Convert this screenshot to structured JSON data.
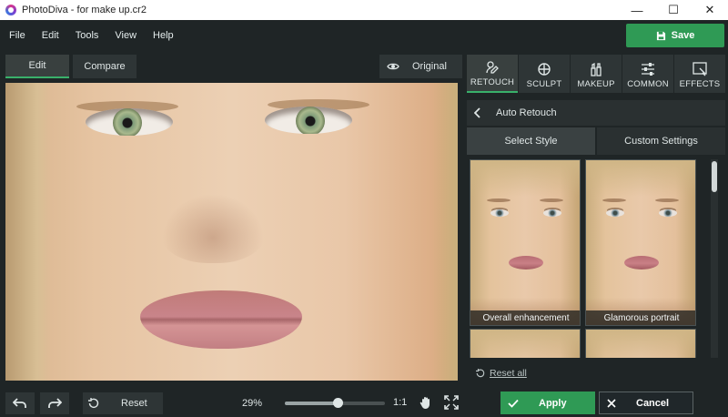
{
  "window": {
    "title": "PhotoDiva - for make up.cr2",
    "minimize": "—",
    "maximize": "☐",
    "close": "✕"
  },
  "menu": [
    "File",
    "Edit",
    "Tools",
    "View",
    "Help"
  ],
  "toolbar": {
    "save_label": "Save",
    "edit_tab": "Edit",
    "compare_tab": "Compare",
    "original_label": "Original"
  },
  "categories": [
    {
      "label": "RETOUCH",
      "icon": "retouch-icon",
      "active": true
    },
    {
      "label": "SCULPT",
      "icon": "sculpt-icon",
      "active": false
    },
    {
      "label": "MAKEUP",
      "icon": "makeup-icon",
      "active": false
    },
    {
      "label": "COMMON",
      "icon": "sliders-icon",
      "active": false
    },
    {
      "label": "EFFECTS",
      "icon": "effects-icon",
      "active": false
    }
  ],
  "panel": {
    "header": "Auto Retouch",
    "tab_select": "Select Style",
    "tab_custom": "Custom Settings",
    "styles": [
      "Overall enhancement",
      "Glamorous portrait"
    ],
    "reset_all": "Reset all"
  },
  "bottom": {
    "reset_label": "Reset",
    "zoom": "29%",
    "zoom_fraction": 0.53,
    "one_to_one": "1:1"
  },
  "actions": {
    "apply_label": "Apply",
    "cancel_label": "Cancel"
  },
  "colors": {
    "accent_green": "#2f9a55",
    "background": "#1f2526",
    "button": "#2e3536"
  }
}
